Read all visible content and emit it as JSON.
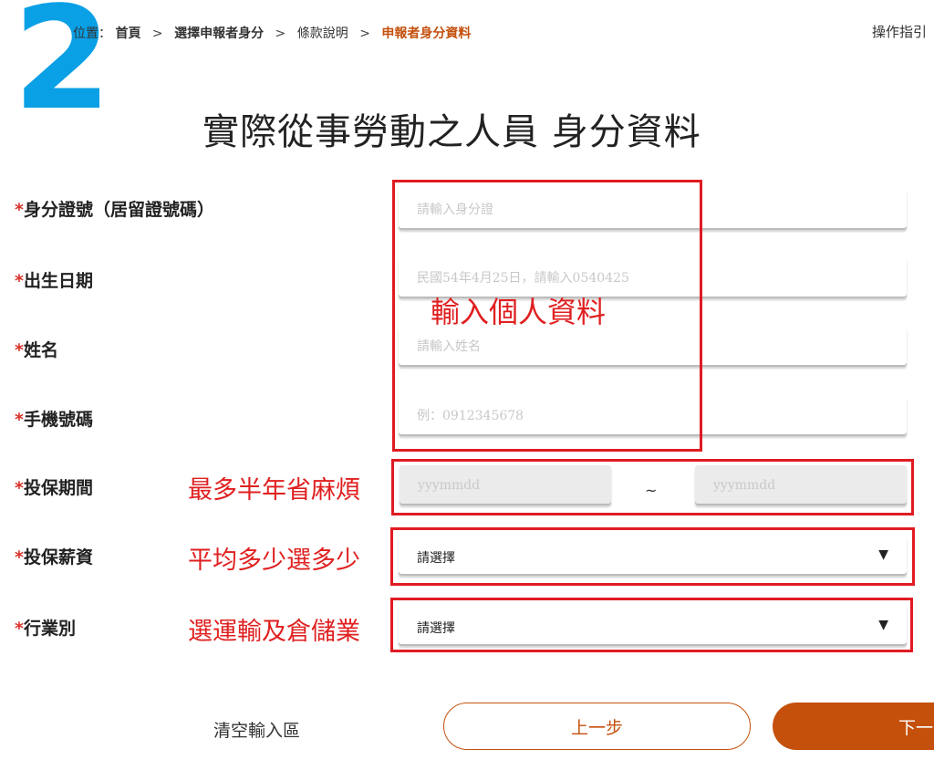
{
  "step_number": "2",
  "breadcrumb": {
    "prefix": "位置：",
    "items": [
      "首頁",
      "選擇申報者身分",
      "條款說明",
      "申報者身分資料"
    ],
    "separator": ">"
  },
  "guide_link": "操作指引",
  "page_title": "實際從事勞動之人員 身分資料",
  "required_mark": "*",
  "fields": {
    "id_number": {
      "label": "身分證號（居留證號碼）",
      "placeholder": "請輸入身分證",
      "value": ""
    },
    "birth_date": {
      "label": "出生日期",
      "placeholder": "民國54年4月25日，請輸入0540425",
      "value": ""
    },
    "name": {
      "label": "姓名",
      "placeholder": "請輸入姓名",
      "value": ""
    },
    "mobile": {
      "label": "手機號碼",
      "placeholder": "例：0912345678",
      "value": ""
    },
    "period": {
      "label": "投保期間",
      "start_placeholder": "yyymmdd",
      "end_placeholder": "yyymmdd",
      "separator": "~"
    },
    "salary": {
      "label": "投保薪資",
      "selected": "請選擇"
    },
    "industry": {
      "label": "行業別",
      "selected": "請選擇"
    }
  },
  "annotations": {
    "personal": "輸入個人資料",
    "period": "最多半年省麻煩",
    "salary": "平均多少選多少",
    "industry": "選運輸及倉儲業"
  },
  "buttons": {
    "clear": "清空輸入區",
    "prev": "上一步",
    "next": "下一"
  },
  "colors": {
    "accent": "#c4500c",
    "required": "#d8322a",
    "annotation": "#e02020",
    "step_number": "#0aa0e6"
  }
}
